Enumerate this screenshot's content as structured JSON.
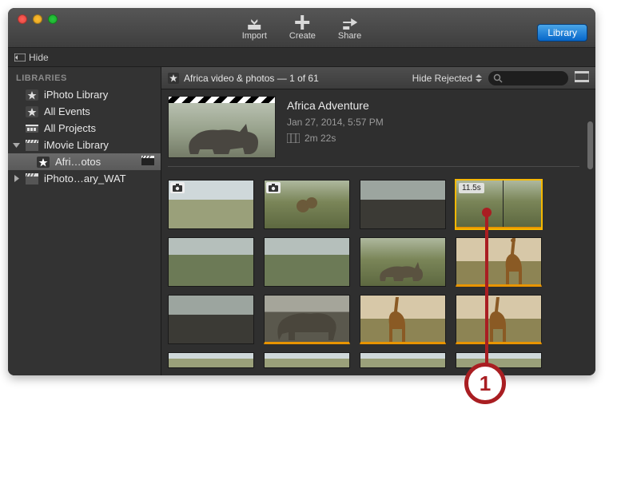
{
  "window": {
    "hide_label": "Hide",
    "library_button": "Library"
  },
  "toolbar": {
    "import": "Import",
    "create": "Create",
    "share": "Share"
  },
  "sidebar": {
    "header": "LIBRARIES",
    "items": [
      {
        "label": "iPhoto Library",
        "icon": "star"
      },
      {
        "label": "All Events",
        "icon": "star"
      },
      {
        "label": "All Projects",
        "icon": "projects"
      },
      {
        "label": "iMovie Library",
        "icon": "clapper",
        "disclosure": "open"
      },
      {
        "label": "Afri…otos",
        "icon": "star",
        "selected": true,
        "badge": "clapper"
      },
      {
        "label": "iPhoto…ary_WAT",
        "icon": "clapper",
        "disclosure": "closed"
      }
    ]
  },
  "eventbar": {
    "title": "Africa video & photos — 1 of 61",
    "filter_label": "Hide Rejected",
    "search_placeholder": ""
  },
  "hero": {
    "title": "Africa Adventure",
    "date": "Jan 27, 2014, 5:57 PM",
    "duration": "2m 22s"
  },
  "clips": [
    {
      "badge": "camera",
      "scene": "sky"
    },
    {
      "badge": "camera",
      "scene": "grass",
      "subject": "monkeys"
    },
    {
      "scene": "road"
    },
    {
      "scene": "grass",
      "selected": true,
      "time_label": "11.5s",
      "scrub": true
    },
    {
      "scene": "tree"
    },
    {
      "scene": "tree"
    },
    {
      "scene": "grass",
      "subject": "rhino"
    },
    {
      "scene": "giraffe",
      "orange": true
    },
    {
      "scene": "road"
    },
    {
      "scene": "elephant",
      "orange": true
    },
    {
      "scene": "giraffe",
      "orange": true
    },
    {
      "scene": "giraffe",
      "orange": true
    },
    {
      "scene": "sky",
      "partial": true
    },
    {
      "scene": "sky",
      "partial": true
    },
    {
      "scene": "sky",
      "partial": true
    },
    {
      "scene": "sky",
      "partial": true
    }
  ],
  "annotation": {
    "number": "1"
  }
}
